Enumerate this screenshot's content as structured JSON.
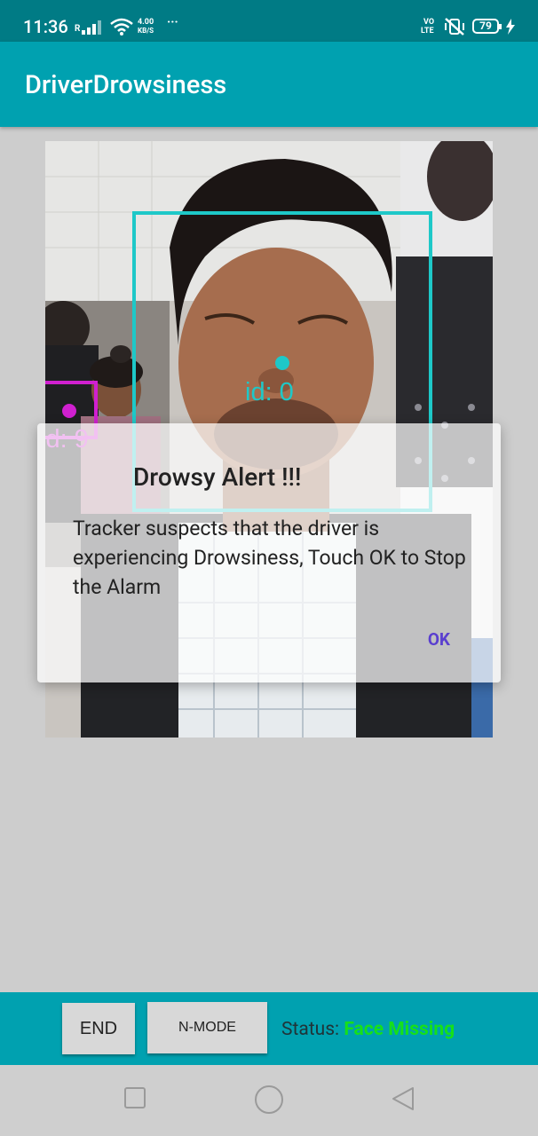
{
  "status_bar": {
    "time": "11:36",
    "network_type": "R",
    "speed_value": "4.00",
    "speed_unit": "KB/S",
    "more": "···",
    "volte_top": "VO",
    "volte_bottom": "LTE",
    "battery": "79",
    "icons": [
      "signal-icon",
      "wifi-icon",
      "volte-icon",
      "mute-vibrate-icon",
      "battery-icon",
      "charging-icon"
    ]
  },
  "app_bar": {
    "title": "DriverDrowsiness"
  },
  "overlay": {
    "main_face_id": "id: 0",
    "second_face_id": "id: 9",
    "main_color": "#1ec8c8",
    "second_color": "#d020d0"
  },
  "dialog": {
    "title": "Drowsy Alert !!!",
    "message": "Tracker suspects that the driver is experiencing Drowsiness, Touch OK to Stop the Alarm",
    "ok_label": "OK"
  },
  "controls": {
    "end_label": "END",
    "mode_label": "N-MODE",
    "status_label": "Status: ",
    "status_value": "Face Missing",
    "status_color": "#16e01a"
  },
  "nav_bar": {
    "icons": [
      "recents-icon",
      "home-icon",
      "back-icon"
    ]
  }
}
